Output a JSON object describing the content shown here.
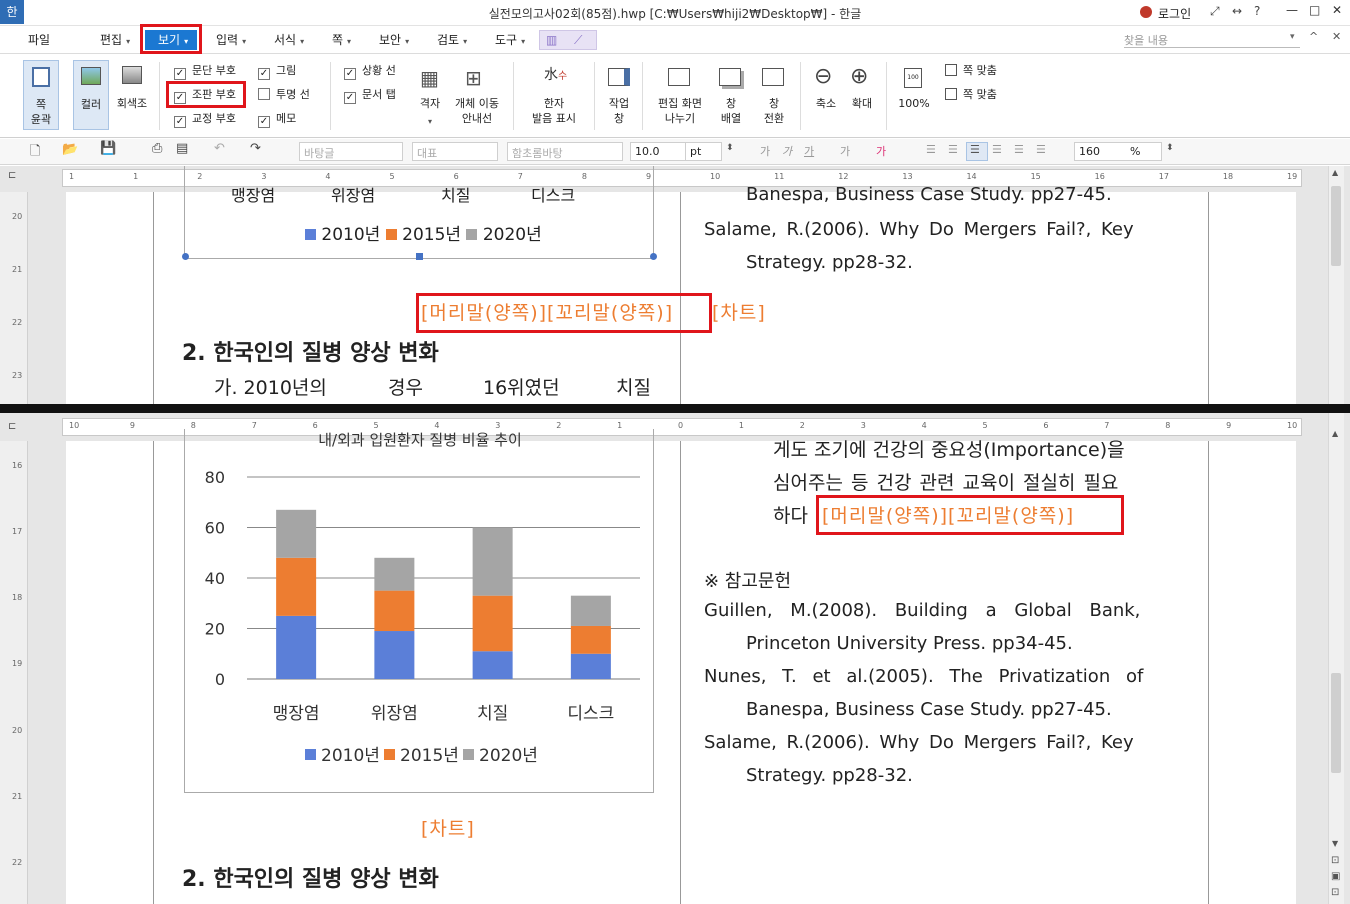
{
  "window": {
    "app_logo": "한",
    "title": "실전모의고사02회(85점).hwp [C:₩Users₩hiji2₩Desktop₩] - 한글",
    "login_label": "로그인",
    "controls": [
      "—",
      "□",
      "✕"
    ]
  },
  "menubar": {
    "items": [
      "파일",
      "편집",
      "보기",
      "입력",
      "서식",
      "쪽",
      "보안",
      "검토",
      "도구"
    ],
    "search_placeholder": "찾을 내용"
  },
  "ribbon": {
    "page_outline": "쪽\n윤곽",
    "color": "컬러",
    "grayscale": "회색조",
    "checks_col1": [
      "문단 부호",
      "조판 부호",
      "교정 부호"
    ],
    "checks_col2": [
      "그림",
      "투명 선",
      "메모"
    ],
    "checks_col3": [
      "상황 선",
      "문서 탭"
    ],
    "grid": "격자",
    "object_move_guide": "개체 이동\n안내선",
    "hanja_pron": "한자\n발음 표시",
    "task_window": "작업\n창",
    "split_edit": "편집 화면\n나누기",
    "arrange_window": "창\n배열",
    "switch_window": "창\n전환",
    "zoom_out": "축소",
    "zoom_in": "확대",
    "zoom_100": "100%",
    "fit_page_1": "쪽 맞춤",
    "fit_page_2": "쪽 맞춤"
  },
  "formatbar": {
    "style": "바탕글",
    "font_lang": "대표",
    "font": "함초롬바탕",
    "size": "10.0",
    "unit": "pt",
    "zoom": "160",
    "zoom_unit": "%"
  },
  "top_pane": {
    "chart_cats_partial": [
      "맹장염",
      "위장염",
      "치질",
      "디스크"
    ],
    "legend": [
      "2010년",
      "2015년",
      "2020년"
    ],
    "marks_line": "[머리말(양쪽)][꼬리말(양쪽)]",
    "chart_mark": "[차트]",
    "heading": "2. 한국인의 질병 양상 변화",
    "body_line": [
      "가. 2010년의",
      "경우",
      "16위였던",
      "치질"
    ],
    "refs": [
      "Banespa, Business Case Study. pp27-45.",
      "Salame, R.(2006). Why Do Mergers Fail?, Key",
      "Strategy. pp28-32."
    ]
  },
  "bottom_pane": {
    "chart_title_partial": "내/외과 입원환자 질병 비율 추이",
    "body_lines": [
      "게도 조기에 건강의 중요성(Importance)을",
      "심어주는 등 건강 관련 교육이 절실히 필요",
      "하다"
    ],
    "marks_line": "[머리말(양쪽)][꼬리말(양쪽)]",
    "refs_title": "※ 참고문헌",
    "refs": [
      "Guillen, M.(2008). Building a Global Bank,",
      "Princeton University Press. pp34-45.",
      "Nunes, T. et al.(2005). The Privatization of",
      "Banespa, Business Case Study. pp27-45.",
      "Salame, R.(2006). Why Do Mergers Fail?, Key",
      "Strategy. pp28-32."
    ],
    "chart_mark": "[차트]",
    "heading": "2. 한국인의 질병 양상 변화"
  },
  "rulers": {
    "top_h": [
      "1",
      "1",
      "2",
      "3",
      "4",
      "5",
      "6",
      "7",
      "8",
      "9",
      "10",
      "11",
      "12",
      "13",
      "14",
      "15",
      "16",
      "17",
      "18",
      "19"
    ],
    "bottom_h": [
      "10",
      "9",
      "8",
      "7",
      "6",
      "5",
      "4",
      "3",
      "2",
      "1",
      "0",
      "1",
      "2",
      "3",
      "4",
      "5",
      "6",
      "7",
      "8",
      "9",
      "10"
    ],
    "top_v": [
      "20",
      "21",
      "22",
      "23"
    ],
    "bottom_v": [
      "16",
      "17",
      "18",
      "19",
      "20",
      "21",
      "22"
    ]
  },
  "chart_data": {
    "type": "bar",
    "stacked": true,
    "title": "내/외과 입원환자 질병 비율 추이",
    "categories": [
      "맹장염",
      "위장염",
      "치질",
      "디스크"
    ],
    "series": [
      {
        "name": "2010년",
        "color": "#5b7fd8",
        "values": [
          25,
          19,
          11,
          10
        ]
      },
      {
        "name": "2015년",
        "color": "#ed7d31",
        "values": [
          23,
          16,
          22,
          11
        ]
      },
      {
        "name": "2020년",
        "color": "#a5a5a5",
        "values": [
          19,
          13,
          27,
          12
        ]
      }
    ],
    "yticks": [
      "0",
      "20",
      "40",
      "60",
      "80"
    ],
    "ylim": [
      0,
      80
    ],
    "legend": "bottom",
    "grid": true
  }
}
